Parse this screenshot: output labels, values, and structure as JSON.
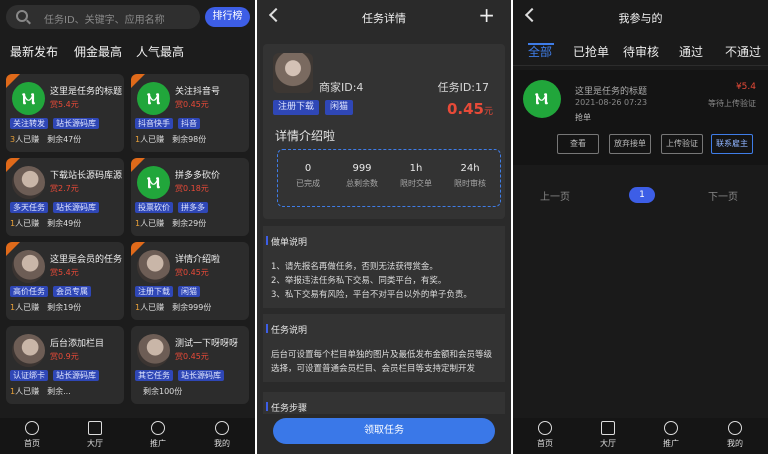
{
  "left": {
    "search_placeholder": "任务ID、关键字、应用名称",
    "rank_button": "排行榜",
    "filters": [
      "最新发布",
      "佣金最高",
      "人气最高"
    ],
    "cards": [
      {
        "title": "这里是任务的标题",
        "price": "赏5.4元",
        "tags": [
          "关注转发",
          "站长源码库"
        ],
        "joined": "3",
        "joined_label": "人已赚",
        "remain": "剩余47份",
        "thumb": "green"
      },
      {
        "title": "关注抖音号",
        "price": "赏0.45元",
        "tags": [
          "抖音快手",
          "抖音"
        ],
        "joined": "1",
        "joined_label": "人已赚",
        "remain": "剩余98份",
        "thumb": "green"
      },
      {
        "title": "下载站长源码库源",
        "price": "赏2.7元",
        "tags": [
          "多天任务",
          "站长源码库"
        ],
        "joined": "1",
        "joined_label": "人已赚",
        "remain": "剩余49份",
        "thumb": "photo"
      },
      {
        "title": "拼多多砍价",
        "price": "赏0.18元",
        "tags": [
          "投票砍价",
          "拼多多"
        ],
        "joined": "1",
        "joined_label": "人已赚",
        "remain": "剩余29份",
        "thumb": "green"
      },
      {
        "title": "这里是会员的任务",
        "price": "赏5.4元",
        "tags": [
          "高价任务",
          "会员专属"
        ],
        "joined": "1",
        "joined_label": "人已赚",
        "remain": "剩余19份",
        "thumb": "photo"
      },
      {
        "title": "详情介绍啦",
        "price": "赏0.45元",
        "tags": [
          "注册下载",
          "闲猫"
        ],
        "joined": "1",
        "joined_label": "人已赚",
        "remain": "剩余999份",
        "thumb": "photo"
      },
      {
        "title": "后台添加栏目",
        "price": "赏0.9元",
        "tags": [
          "认证绑卡",
          "站长源码库"
        ],
        "joined": "1",
        "joined_label": "人已赚",
        "remain": "剩余...",
        "thumb": "photo"
      },
      {
        "title": "测试一下呀呀呀",
        "price": "赏0.45元",
        "tags": [
          "其它任务",
          "站长源码库"
        ],
        "joined": "",
        "joined_label": "",
        "remain": "剩余100份",
        "thumb": "photo"
      }
    ],
    "tabbar": [
      "首页",
      "大厅",
      "推广",
      "我的"
    ]
  },
  "middle": {
    "title": "任务详情",
    "plus": "+",
    "merchant": "商家ID:4",
    "task_id": "任务ID:17",
    "tags": [
      "注册下载",
      "闲猫"
    ],
    "price": "0.45",
    "price_unit": "元",
    "intro": "详情介绍啦",
    "stats": [
      {
        "value": "0",
        "label": "已完成"
      },
      {
        "value": "999",
        "label": "总剩余数"
      },
      {
        "value": "1h",
        "label": "限时交单"
      },
      {
        "value": "24h",
        "label": "限时审核"
      }
    ],
    "rules_title": "做单说明",
    "rules": [
      "1、请先报名再做任务，否则无法获得赏金。",
      "2、举报违法任务私下交易、同类平台，有奖。",
      "3、私下交易有风险，平台不对平台以外的单子负责。"
    ],
    "desc_title": "任务说明",
    "desc": "后台可设置每个栏目单独的图片及最低发布金额和会员等级选择，可设置普通会员栏目、会员栏目等支持定制开发",
    "steps_title": "任务步骤",
    "claim_button": "领取任务"
  },
  "right": {
    "title": "我参与的",
    "tabs": [
      "全部",
      "已抢单",
      "待审核",
      "通过",
      "不通过"
    ],
    "item": {
      "title": "这里是任务的标题",
      "date": "2021-08-26 07:23",
      "type": "抢单",
      "price": "¥5.4",
      "status": "等待上传验证",
      "buttons": [
        "查看",
        "放弃接单",
        "上传验证",
        "联系雇主"
      ]
    },
    "pager": {
      "prev": "上一页",
      "page": "1",
      "next": "下一页"
    },
    "tabbar": [
      "首页",
      "大厅",
      "推广",
      "我的"
    ]
  },
  "colors": {
    "accent": "#3d5ee6",
    "price": "#e84a38",
    "brand_green": "#21a63b",
    "badge_orange": "#e06a1a"
  }
}
